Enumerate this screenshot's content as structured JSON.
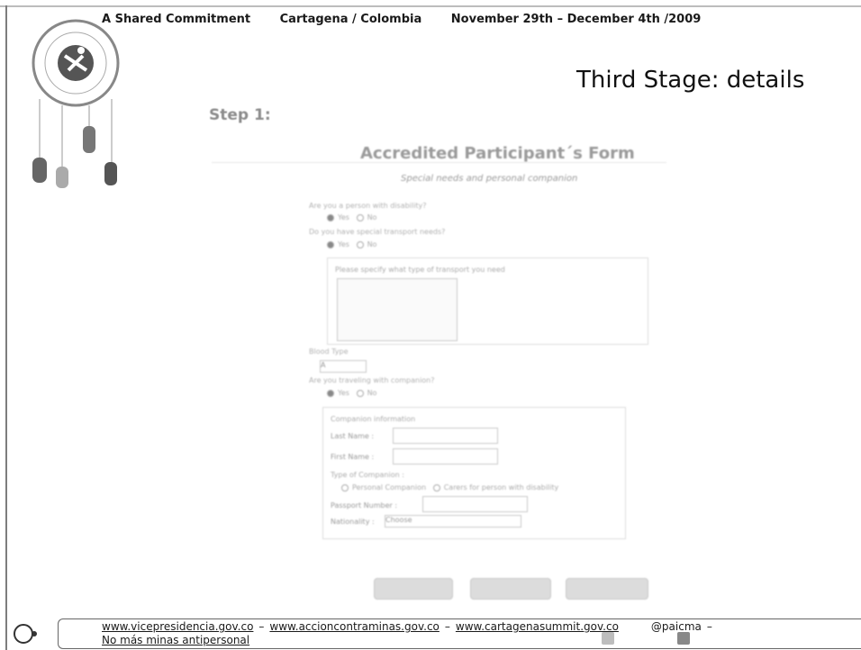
{
  "header": {
    "commitment": "A Shared Commitment",
    "location": "Cartagena / Colombia",
    "dates": "November 29th  – December 4th  /2009"
  },
  "slide_title": "Third Stage: details",
  "form": {
    "step_label": "Step 1:",
    "title": "Accredited Participant´s Form",
    "subtitle": "Special needs and personal companion",
    "q1": "Are you a person with disability?",
    "q2": "Do you have special transport needs?",
    "q3": "Are you traveling with companion?",
    "yes": "Yes",
    "no": "No",
    "transport_label": "Please specify what type of transport you need",
    "blood_type": "Blood Type",
    "companion_info": "Companion information",
    "last_name": "Last Name :",
    "first_name": "First Name :",
    "type_of_companion": "Type of Companion :",
    "personal_companion": "Personal Companion",
    "carers": "Carers for person with disability",
    "passport": "Passport Number :",
    "nationality": "Nationality :",
    "nationality_value": "Choose",
    "blood_value": "A"
  },
  "footer": {
    "link1": "www.vicepresidencia.gov.co",
    "link2": "www.accioncontraminas.gov.co",
    "link3": "www.cartagenasummit.gov.co",
    "handle": "@paicma",
    "link4": "No más minas antipersonal"
  }
}
